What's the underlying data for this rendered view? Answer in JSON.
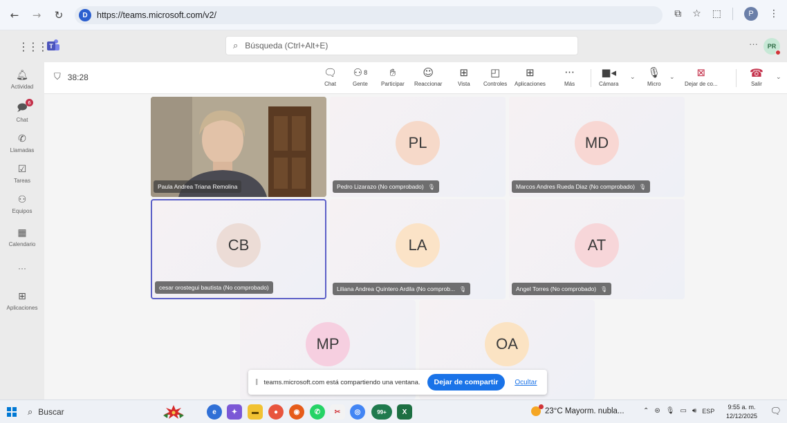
{
  "browser": {
    "url": "https://teams.microsoft.com/v2/",
    "site_badge": "D",
    "profile_initial": "P"
  },
  "teams": {
    "search_placeholder": "Búsqueda (Ctrl+Alt+E)",
    "more": "···",
    "avatar_initials": "PR"
  },
  "rail": {
    "items": [
      {
        "label": "Actividad",
        "icon": "bell-icon"
      },
      {
        "label": "Chat",
        "icon": "chat-icon",
        "badge": "6"
      },
      {
        "label": "Llamadas",
        "icon": "phone-icon"
      },
      {
        "label": "Tareas",
        "icon": "tasks-icon"
      },
      {
        "label": "Equipos",
        "icon": "teams-icon"
      },
      {
        "label": "Calendario",
        "icon": "calendar-icon"
      },
      {
        "label": "···",
        "icon": "more-icon"
      },
      {
        "label": "Aplicaciones",
        "icon": "apps-icon"
      }
    ]
  },
  "meeting": {
    "timer": "38:28",
    "toolbar": {
      "chat": "Chat",
      "people": "Gente",
      "people_count": "8",
      "raise": "Participar",
      "react": "Reaccionar",
      "view": "Vista",
      "controls": "Controles",
      "apps": "Aplicaciones",
      "more": "Más",
      "camera": "Cámara",
      "mic": "Micro",
      "stop_share": "Dejar de co...",
      "leave": "Salir"
    },
    "tiles": [
      {
        "name": "Paula Andrea Triana Remolina",
        "initials": "",
        "video": true
      },
      {
        "name": "Pedro Lizarazo (No comprobado)",
        "initials": "PL",
        "muted": true
      },
      {
        "name": "Marcos Andres Rueda Diaz (No comprobado)",
        "initials": "MD",
        "muted": true
      },
      {
        "name": "cesar orostegui bautista (No comprobado)",
        "initials": "CB",
        "active": true
      },
      {
        "name": "Liliana Andrea Quintero Ardila (No comprob...",
        "initials": "LA",
        "muted": true
      },
      {
        "name": "Angel Torres (No comprobado)",
        "initials": "AT",
        "muted": true
      },
      {
        "name": "",
        "initials": "MP"
      },
      {
        "name": "",
        "initials": "OA"
      }
    ]
  },
  "share_banner": {
    "text": "teams.microsoft.com está compartiendo una ventana.",
    "stop": "Dejar de compartir",
    "hide": "Ocultar"
  },
  "taskbar": {
    "search": "Buscar",
    "weather": "23°C  Mayorm. nubla...",
    "language": "ESP",
    "time": "9:55 a. m.",
    "date": "12/12/2025",
    "badge_99": "99+"
  },
  "colors": {
    "accent": "#5b5fc7",
    "leave": "#c4314b",
    "share_stop": "#1a73e8"
  }
}
